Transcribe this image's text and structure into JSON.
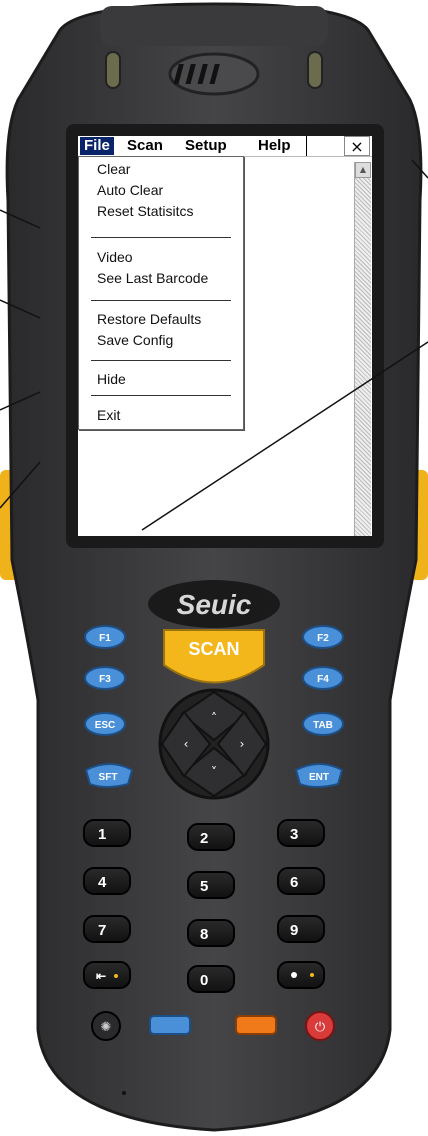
{
  "brand": "Seuic",
  "menubar": {
    "file": "File",
    "scan": "Scan",
    "setup": "Setup",
    "help": "Help",
    "close": "×"
  },
  "file_menu": {
    "items": [
      "Clear",
      "Auto Clear",
      "Reset Statisitcs",
      "Video",
      "See Last Barcode",
      "Restore Defaults",
      "Save Config",
      "Hide",
      "Exit"
    ]
  },
  "keypad": {
    "scan": "SCAN",
    "f1": "F1",
    "f2": "F2",
    "f3": "F3",
    "f4": "F4",
    "esc": "ESC",
    "tab": "TAB",
    "sft": "SFT",
    "ent": "ENT",
    "digits": [
      "1",
      "2",
      "3",
      "4",
      "5",
      "6",
      "7",
      "8",
      "9",
      "0"
    ]
  },
  "colors": {
    "body": "#3c3c3e",
    "scan_key": "#f3b71b",
    "side_grip": "#f0b21b",
    "blue_key": "#4a90d9",
    "orange_key": "#f07a1a",
    "power_key": "#d93a3a",
    "menu_highlight": "#0a246a"
  }
}
